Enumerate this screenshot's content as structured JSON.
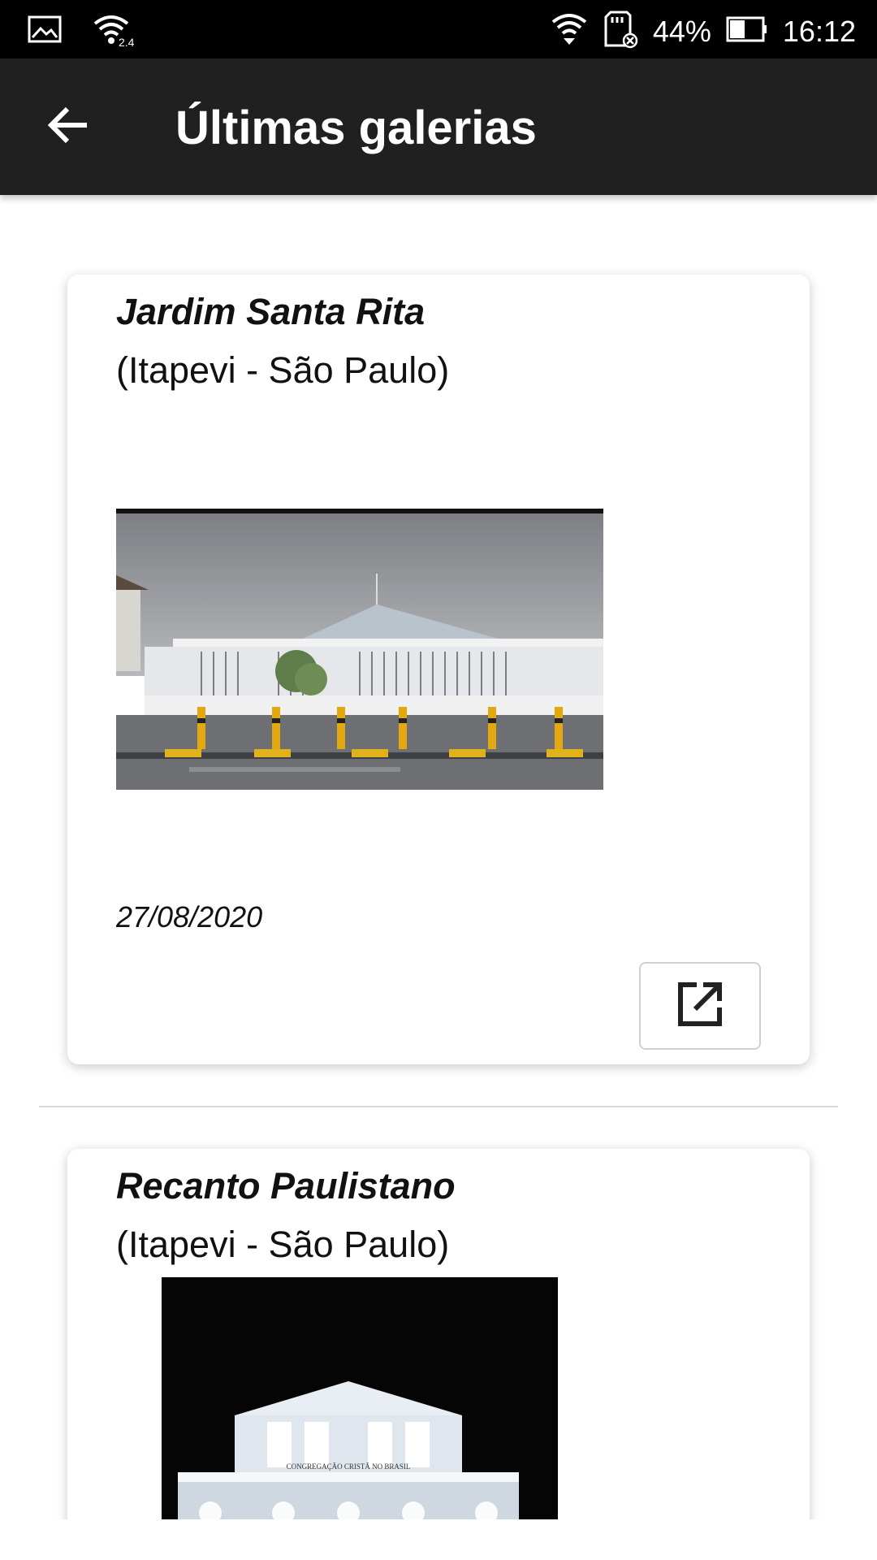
{
  "status_bar": {
    "battery_percent": "44%",
    "time": "16:12",
    "wifi_badge": "2.4",
    "icons": [
      "gallery-icon",
      "wifi-icon",
      "wifi-signal-icon",
      "sd-card-icon",
      "battery-icon"
    ]
  },
  "app_bar": {
    "title": "Últimas galerias",
    "back_icon": "arrow-left-icon"
  },
  "galleries": [
    {
      "title": "Jardim Santa Rita",
      "location": "(Itapevi - São Paulo)",
      "date": "27/08/2020",
      "open_icon": "open-external-icon"
    },
    {
      "title": "Recanto Paulistano",
      "location": "(Itapevi - São Paulo)",
      "photo_sign": "CONGREGAÇÃO CRISTÃ NO BRASIL"
    }
  ]
}
